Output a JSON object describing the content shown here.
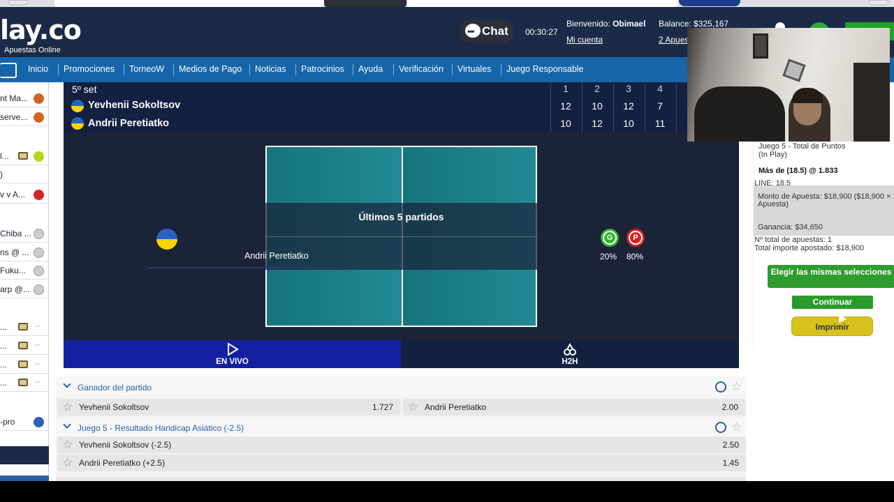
{
  "browser": {
    "badge_text": "Chat"
  },
  "header": {
    "logo_text": "lay.co",
    "logo_subtitle": "Apuestas Online",
    "chat_label": "Chat",
    "clock": "00:30:27",
    "welcome_label": "Bienvenido:",
    "user_name": "Obimael",
    "balance_label": "Balance: $325,167",
    "account_link": "Mi cuenta",
    "bets_link": "2 Apues"
  },
  "nav": {
    "items": [
      "Inicio",
      "Promociones",
      "TorneoW",
      "Medios de Pago",
      "Noticias",
      "Patrocinios",
      "Ayuda",
      "Verificación",
      "Virtuales",
      "Juego Responsable"
    ]
  },
  "sidebar": {
    "items": [
      {
        "label": "nt Ma...",
        "icon": "basketball-icon",
        "color": "#d2631f"
      },
      {
        "label": "serve...",
        "icon": "basketball-icon",
        "color": "#d2631f"
      },
      {
        "label": "l...",
        "icon": "tennis-ball-icon",
        "color": "#b7d51c"
      },
      {
        "label": ")",
        "icon": "",
        "color": ""
      },
      {
        "label": "v v A...",
        "icon": "ping-pong-icon",
        "color": "#d6232a"
      },
      {
        "label": "Chiba ...",
        "icon": "baseball-icon",
        "color": "#cccccc"
      },
      {
        "label": "ns @ ...",
        "icon": "baseball-icon",
        "color": "#cccccc"
      },
      {
        "label": "Fuku...",
        "icon": "baseball-icon",
        "color": "#cccccc"
      },
      {
        "label": "arp @...",
        "icon": "baseball-icon",
        "color": "#cccccc"
      },
      {
        "label": "...",
        "icon": "tv-icon",
        "color": ""
      },
      {
        "label": "...",
        "icon": "tv-icon",
        "color": ""
      },
      {
        "label": "...",
        "icon": "tv-icon",
        "color": ""
      },
      {
        "label": "...",
        "icon": "tv-icon",
        "color": ""
      },
      {
        "label": "-pro",
        "icon": "volleyball-icon",
        "color": "#2a63b8"
      }
    ]
  },
  "match": {
    "set_label": "5º set",
    "set_headers": [
      "1",
      "2",
      "3",
      "4"
    ],
    "players": [
      {
        "name": "Yevhenii Sokoltsov",
        "scores": [
          "12",
          "10",
          "12",
          "7"
        ]
      },
      {
        "name": "Andrii Peretiatko",
        "scores": [
          "10",
          "12",
          "10",
          "11"
        ]
      }
    ],
    "overlay_title": "Últimos 5 partidos",
    "overlay_player": "Andrii Peretiatko",
    "stats": [
      {
        "letter": "G",
        "pct": "20%",
        "color": "#2fb52f"
      },
      {
        "letter": "P",
        "pct": "80%",
        "color": "#d61f1f"
      }
    ],
    "tabs": {
      "live": "EN VIVO",
      "h2h": "H2H"
    }
  },
  "markets": [
    {
      "title": "Ganador del partido",
      "odds": [
        {
          "name": "Yevhenii Sokoltsov",
          "value": "1.727"
        },
        {
          "name": "Andrii Peretiatko",
          "value": "2.00"
        }
      ]
    },
    {
      "title": "Juego 5 - Resultado Handicap Asiático (-2.5)",
      "odds": [
        {
          "name": "Yevhenii Sokoltsov (-2.5)",
          "value": "2.50"
        },
        {
          "name": "Andrii Peretiatko (+2.5)",
          "value": "1.45"
        }
      ]
    }
  ],
  "slip": {
    "market": "Juego 5 - Total de Puntos",
    "inplay": "(In Play)",
    "selection": "Más de (18.5) @ 1.833",
    "line": "LINE: 18.5",
    "stake_1": "Monto de Apuesta: $18,900 ($18,900 × 1",
    "stake_2": "Apuesta)",
    "profit": "Ganancia: $34,650",
    "total_bets": "Nº total de apuestas: 1",
    "total_amount": "Total importe apostado:  $18,900",
    "btn_same": "Elegir las mismas selecciones",
    "btn_continue": "Continuar",
    "btn_print": "Imprimir"
  },
  "colors": {
    "header": "#1b2a47",
    "nav": "#1665a8",
    "match_bg": "#1b2339",
    "court": "#18838f",
    "live_tab": "#1420a0",
    "link": "#2a5ea8"
  }
}
